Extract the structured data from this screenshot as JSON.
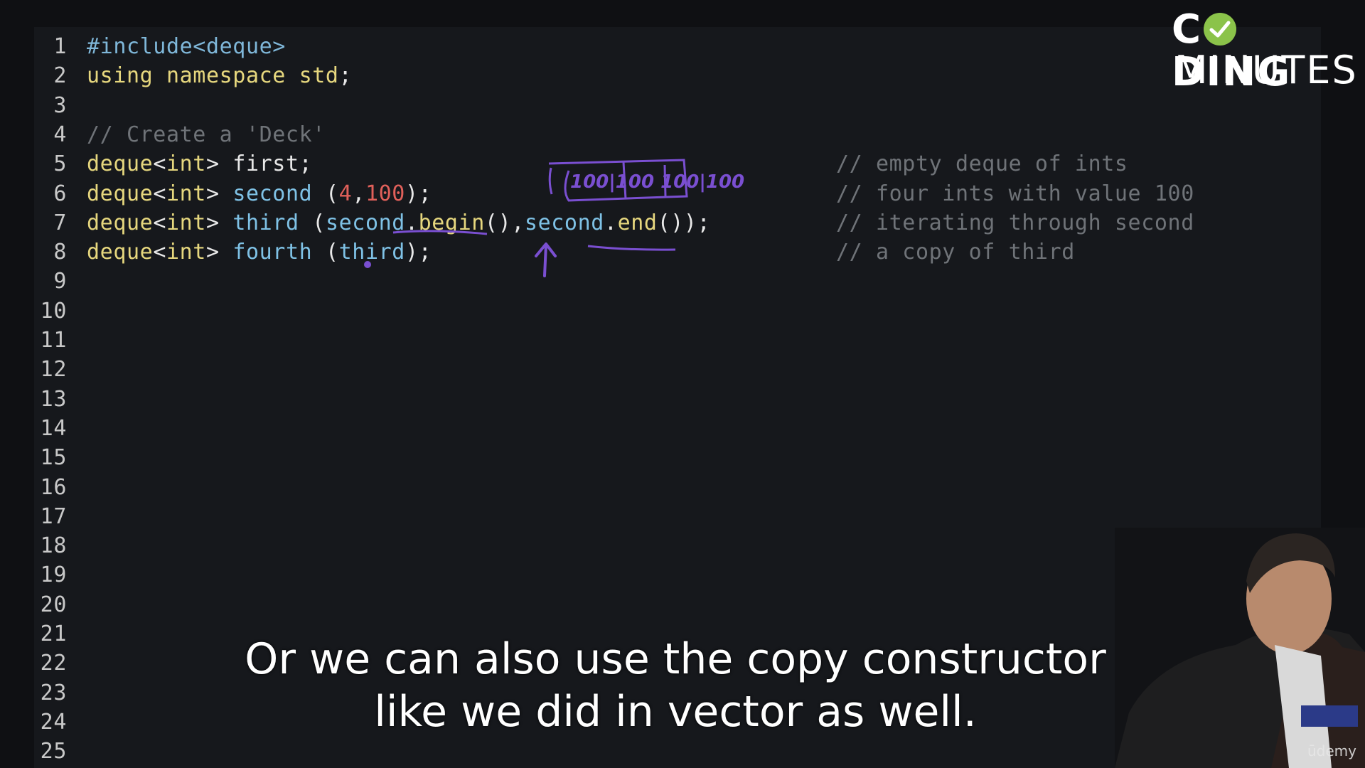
{
  "logo": {
    "line1_prefix": "C",
    "line1_suffix": "DING",
    "line2": "MINUTES",
    "icon": "check-circle-icon",
    "accent": "#8bc34a"
  },
  "code": {
    "lines": [
      {
        "n": "1",
        "parts": [
          [
            "inc",
            "#include<deque>"
          ]
        ]
      },
      {
        "n": "2",
        "parts": [
          [
            "kw",
            "using namespace "
          ],
          [
            "kw",
            "std"
          ],
          [
            "plain",
            ";"
          ]
        ]
      },
      {
        "n": "3",
        "parts": []
      },
      {
        "n": "4",
        "parts": [
          [
            "cm",
            "// Create a 'Deck'"
          ]
        ]
      },
      {
        "n": "5",
        "parts": [
          [
            "kw",
            "deque"
          ],
          [
            "plain",
            "<"
          ],
          [
            "kw",
            "int"
          ],
          [
            "plain",
            "> first;"
          ]
        ]
      },
      {
        "n": "6",
        "parts": [
          [
            "kw",
            "deque"
          ],
          [
            "plain",
            "<"
          ],
          [
            "kw",
            "int"
          ],
          [
            "plain",
            "> "
          ],
          [
            "id",
            "second"
          ],
          [
            "plain",
            " ("
          ],
          [
            "num",
            "4"
          ],
          [
            "plain",
            ","
          ],
          [
            "num",
            "100"
          ],
          [
            "plain",
            ");"
          ]
        ]
      },
      {
        "n": "7",
        "parts": [
          [
            "kw",
            "deque"
          ],
          [
            "plain",
            "<"
          ],
          [
            "kw",
            "int"
          ],
          [
            "plain",
            "> "
          ],
          [
            "id",
            "third"
          ],
          [
            "plain",
            " ("
          ],
          [
            "id",
            "second"
          ],
          [
            "plain",
            "."
          ],
          [
            "kw",
            "begin"
          ],
          [
            "plain",
            "(),"
          ],
          [
            "id",
            "second"
          ],
          [
            "plain",
            "."
          ],
          [
            "kw",
            "end"
          ],
          [
            "plain",
            "());"
          ]
        ]
      },
      {
        "n": "8",
        "parts": [
          [
            "kw",
            "deque"
          ],
          [
            "plain",
            "<"
          ],
          [
            "kw",
            "int"
          ],
          [
            "plain",
            "> "
          ],
          [
            "id",
            "fourth"
          ],
          [
            "plain",
            " ("
          ],
          [
            "id",
            "third"
          ],
          [
            "plain",
            ");"
          ]
        ]
      },
      {
        "n": "9",
        "parts": []
      },
      {
        "n": "10",
        "parts": []
      },
      {
        "n": "11",
        "parts": []
      },
      {
        "n": "12",
        "parts": []
      },
      {
        "n": "13",
        "parts": []
      },
      {
        "n": "14",
        "parts": []
      },
      {
        "n": "15",
        "parts": []
      },
      {
        "n": "16",
        "parts": []
      },
      {
        "n": "17",
        "parts": []
      },
      {
        "n": "18",
        "parts": []
      },
      {
        "n": "19",
        "parts": []
      },
      {
        "n": "20",
        "parts": []
      },
      {
        "n": "21",
        "parts": []
      },
      {
        "n": "22",
        "parts": []
      },
      {
        "n": "23",
        "parts": []
      },
      {
        "n": "24",
        "parts": []
      },
      {
        "n": "25",
        "parts": []
      }
    ],
    "comments": [
      {
        "line": 5,
        "text": "// empty deque of ints"
      },
      {
        "line": 6,
        "text": "// four ints with value 100"
      },
      {
        "line": 7,
        "text": "// iterating through second"
      },
      {
        "line": 8,
        "text": "// a copy of third"
      }
    ]
  },
  "annotation": {
    "boxes_text": "100|100 100|100",
    "color": "#7a4fd1"
  },
  "subtitle": {
    "line1": "Or we can also use the copy constructor",
    "line2": "like we did in vector as well."
  },
  "watermark": "ūdemy"
}
